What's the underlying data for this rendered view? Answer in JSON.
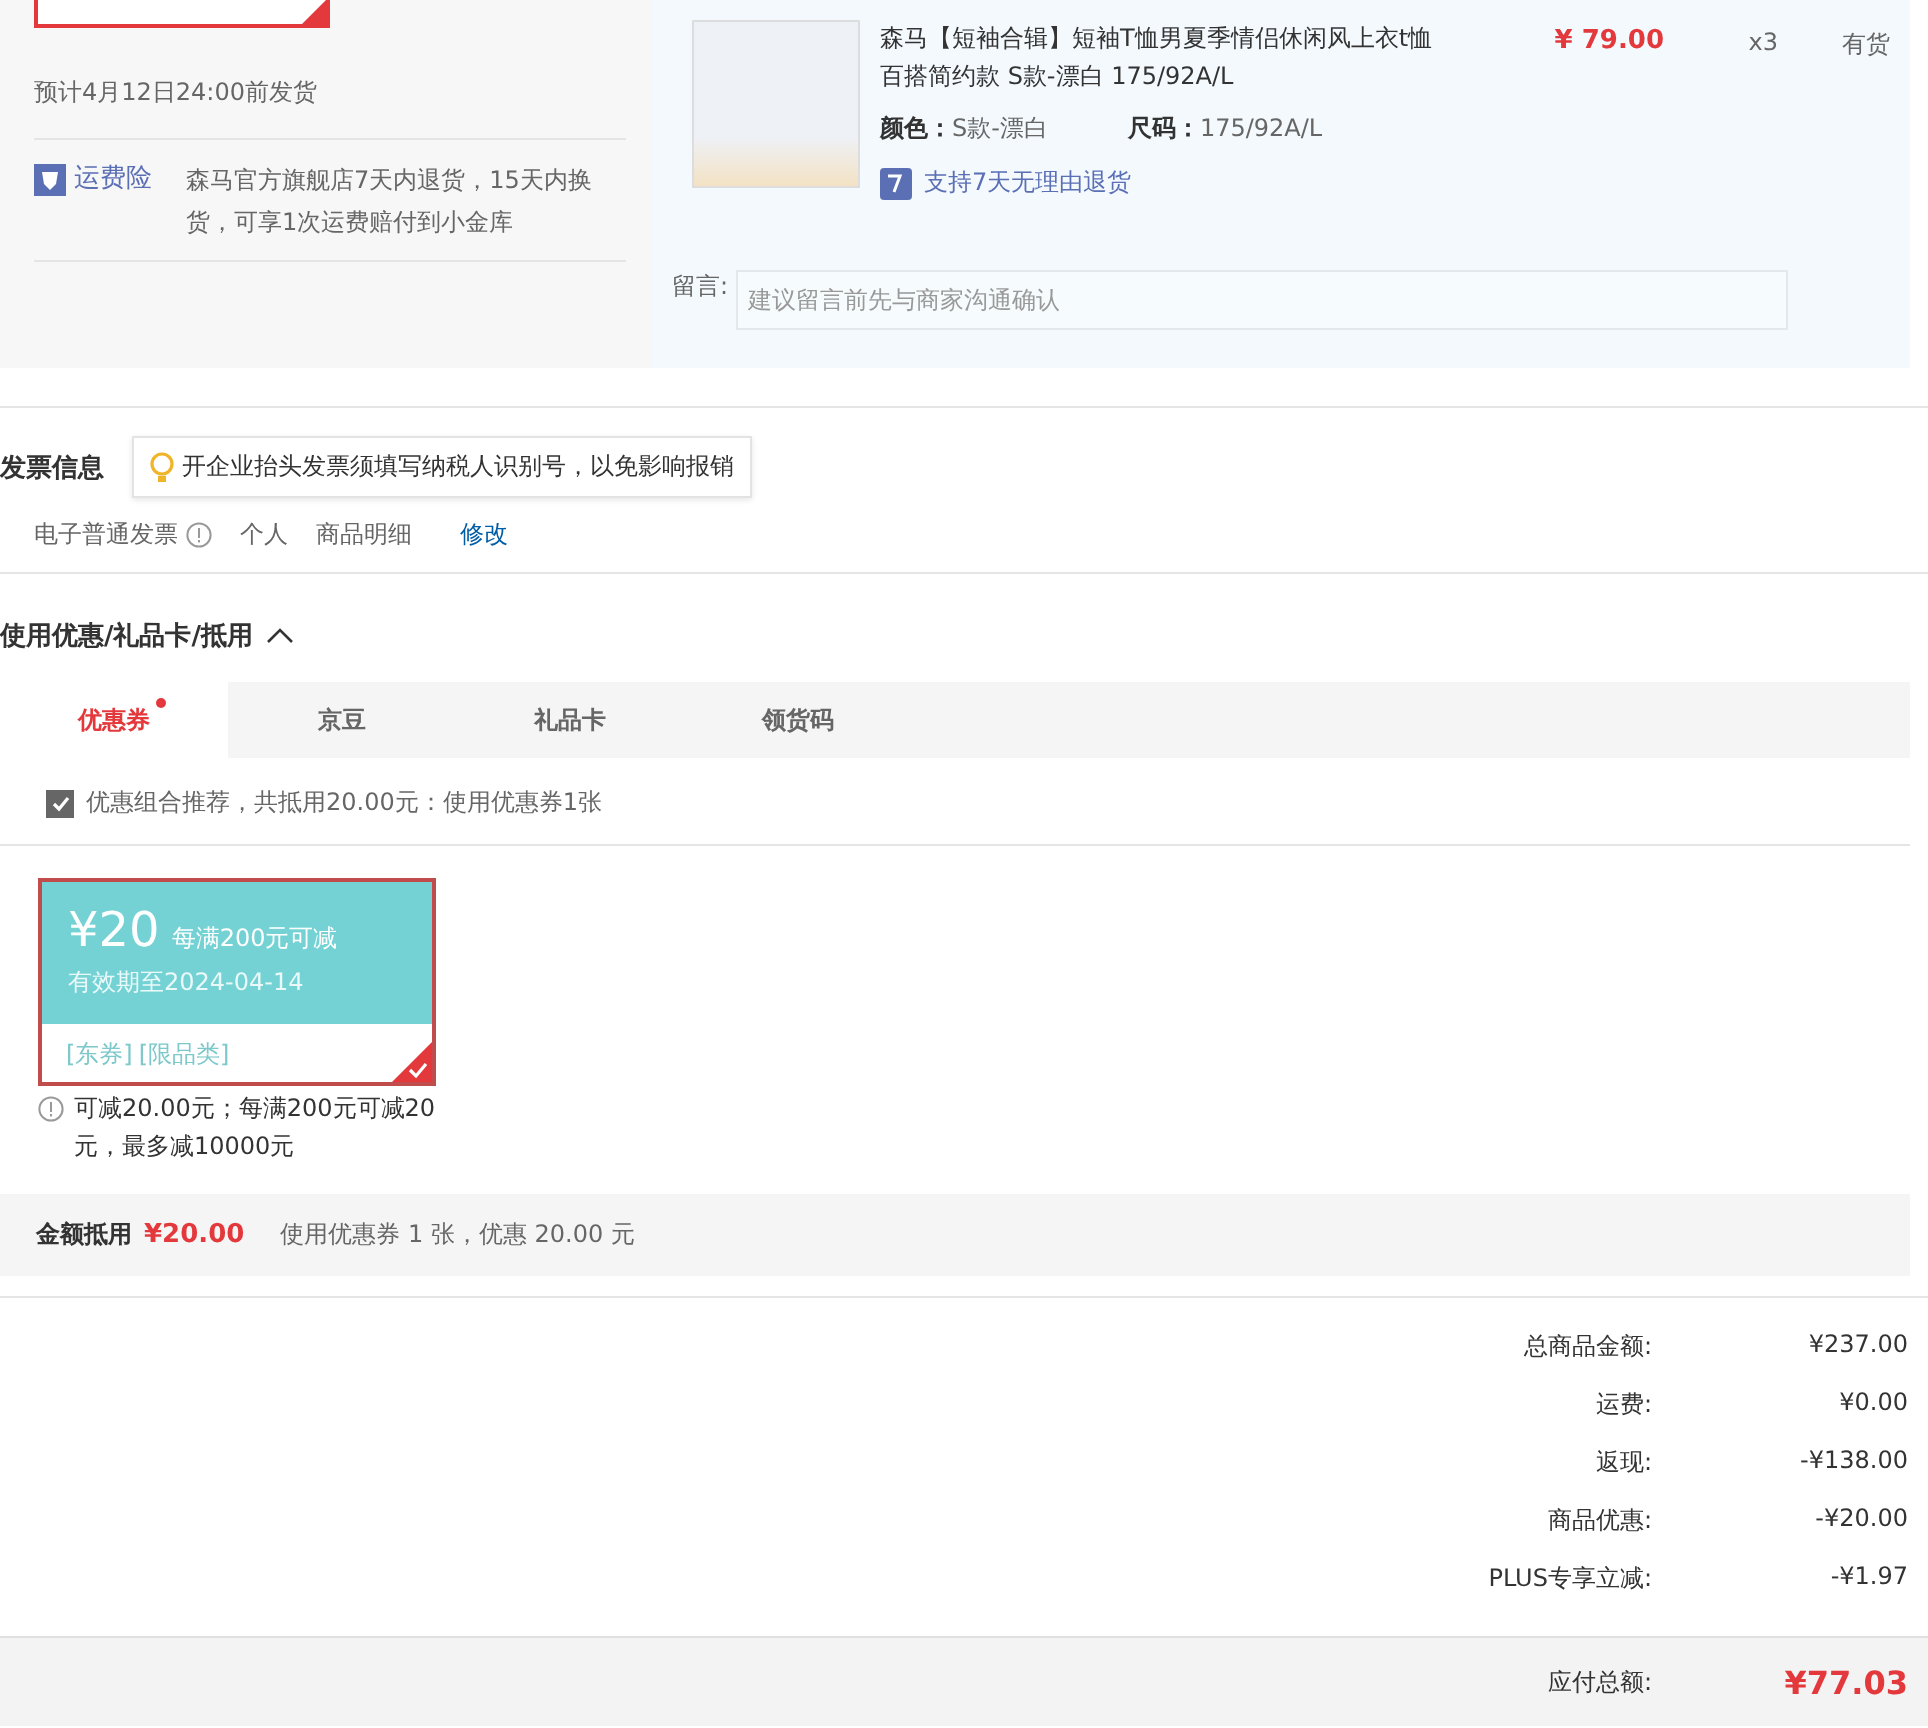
{
  "shipping": {
    "estimate": "预计4月12日24:00前发货",
    "insurance_label": "运费险",
    "insurance_text": "森马官方旗舰店7天内退货，15天内换货，可享1次运费赔付到小金库"
  },
  "product": {
    "title": "森马【短袖合辑】短袖T恤男夏季情侣休闲风上衣t恤百搭简约款 S款-漂白 175/92A/L",
    "price": "¥ 79.00",
    "quantity": "x3",
    "stock": "有货",
    "color_label": "颜色：",
    "color_value": "S款-漂白",
    "size_label": "尺码：",
    "size_value": "175/92A/L",
    "return_policy": "支持7天无理由退货",
    "note_label": "留言:",
    "note_placeholder": "建议留言前先与商家沟通确认"
  },
  "invoice": {
    "title": "发票信息",
    "tip": "开企业抬头发票须填写纳税人识别号，以免影响报销",
    "type": "电子普通发票",
    "holder": "个人",
    "content": "商品明细",
    "edit_link": "修改"
  },
  "discounts": {
    "title": "使用优惠/礼品卡/抵用",
    "expanded": true,
    "tabs": [
      {
        "label": "优惠券",
        "selected": true,
        "dot": true
      },
      {
        "label": "京豆",
        "selected": false,
        "dot": false
      },
      {
        "label": "礼品卡",
        "selected": false,
        "dot": false
      },
      {
        "label": "领货码",
        "selected": false,
        "dot": false
      }
    ],
    "recommend": {
      "checked": true,
      "text": "优惠组合推荐，共抵用20.00元：使用优惠券1张"
    },
    "coupons": [
      {
        "amount": "¥20",
        "condition": "每满200元可减",
        "validity": "有效期至2024-04-14",
        "tags": [
          "[东券]",
          "[限品类]"
        ],
        "selected": true,
        "note": "可减20.00元；每满200元可减20元，最多减10000元"
      }
    ],
    "summary_label": "金额抵用",
    "summary_amount": "¥20.00",
    "summary_text": "使用优惠券 1 张，优惠 20.00 元"
  },
  "totals": [
    {
      "label": "总商品金额:",
      "value": "¥237.00"
    },
    {
      "label": "运费:",
      "value": "¥0.00"
    },
    {
      "label": "返现:",
      "value": "-¥138.00"
    },
    {
      "label": "商品优惠:",
      "value": "-¥20.00"
    },
    {
      "label": "PLUS专享立减:",
      "value": "-¥1.97"
    }
  ],
  "payable": {
    "label": "应付总额:",
    "value": "¥77.03"
  }
}
